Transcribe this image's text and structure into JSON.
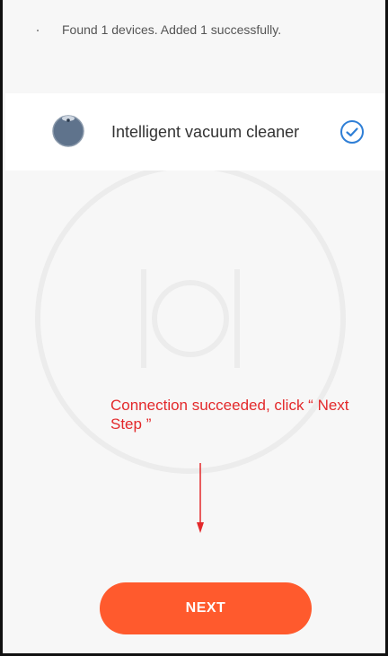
{
  "status": {
    "message": "Found 1 devices. Added 1 successfully."
  },
  "device": {
    "name": "Intelligent vacuum cleaner",
    "icon": "robot-vacuum-icon",
    "status_icon": "check-circle-icon",
    "accent_color": "#2f7fd6"
  },
  "annotation": {
    "text": "Connection succeeded, click “ Next Step ”",
    "color": "#e3292b"
  },
  "actions": {
    "next_label": "NEXT",
    "button_color": "#ff5a2d"
  }
}
